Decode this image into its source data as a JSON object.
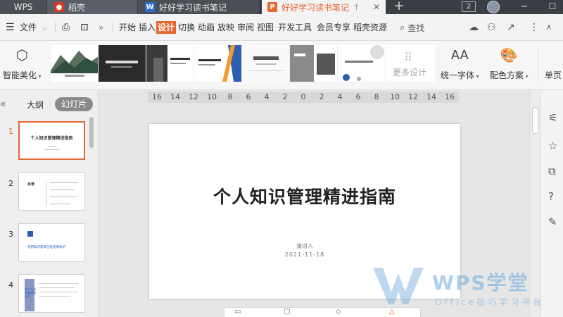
{
  "titlebar": {
    "tabs": [
      {
        "label": "WPS"
      },
      {
        "label": "稻壳"
      },
      {
        "label": "好好学习读书笔记"
      },
      {
        "label": "好好学习读书笔记"
      }
    ],
    "window_count": "2"
  },
  "menubar": {
    "file_label": "文件",
    "tabs": [
      "开始",
      "插入",
      "设计",
      "切换",
      "动画",
      "放映",
      "审阅",
      "视图",
      "开发工具",
      "会员专享",
      "稻壳资源"
    ],
    "active_tab": "设计",
    "search_label": "查找"
  },
  "ribbon": {
    "smart_beautify": "智能美化",
    "more_design": "更多设计",
    "unify_font": "统一字体",
    "color_scheme": "配色方案",
    "single_page": "单页"
  },
  "sidebar": {
    "outline_label": "大纲",
    "slides_label": "幻灯片",
    "slide_numbers": [
      "1",
      "2",
      "3",
      "4"
    ],
    "thumb1_title": "个人知识管理精进指南",
    "thumb2_heading": "目录",
    "thumb3_title": "借用知识新来已经成果知识",
    "thumb4_title": "在个人知识管理成长中"
  },
  "ruler": {
    "ticks": [
      "16",
      "14",
      "12",
      "10",
      "8",
      "6",
      "4",
      "2",
      "0",
      "2",
      "4",
      "6",
      "8",
      "10",
      "12",
      "14",
      "16"
    ]
  },
  "slide": {
    "title": "个人知识管理精进指南",
    "presenter": "演讲人",
    "date": "2021-11-18"
  },
  "watermark": {
    "brand": "WPS学堂",
    "subtitle": "Office技巧学习平台"
  },
  "colors": {
    "accent": "#e7662f",
    "titlebar": "#3b3f45",
    "doc_blue": "#2b6fd6",
    "ppt_orange": "#e7662f",
    "daoke_red": "#d33a2c"
  }
}
